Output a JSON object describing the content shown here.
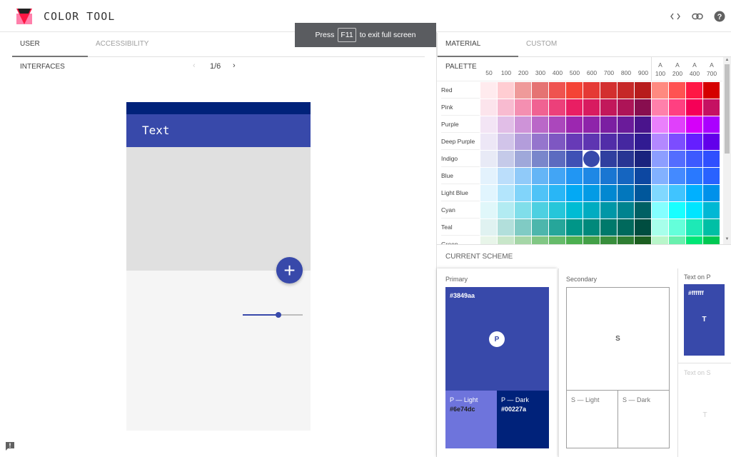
{
  "app": {
    "title": "COLOR TOOL"
  },
  "header_icons": [
    {
      "name": "code-icon",
      "glyph": "<>"
    },
    {
      "name": "link-icon",
      "glyph": "link"
    },
    {
      "name": "help-icon",
      "glyph": "?"
    }
  ],
  "left_tabs": [
    {
      "label": "USER INTERFACES",
      "active": true
    },
    {
      "label": "ACCESSIBILITY",
      "active": false
    }
  ],
  "pager": {
    "prev": "‹",
    "current": "1/6",
    "next": "›"
  },
  "toast": {
    "prefix": "Press",
    "key": "F11",
    "suffix": "to exit full screen"
  },
  "preview": {
    "appbar_text": "Text",
    "fab_glyph": "+",
    "slider_value": 0.6
  },
  "right_tabs": [
    {
      "label": "MATERIAL PALETTE",
      "active": true
    },
    {
      "label": "CUSTOM",
      "active": false
    }
  ],
  "palette": {
    "columns": [
      "50",
      "100",
      "200",
      "300",
      "400",
      "500",
      "600",
      "700",
      "800",
      "900",
      "A 100",
      "A 200",
      "A 400",
      "A 700"
    ],
    "selected": {
      "row": "Indigo",
      "column": "600"
    },
    "rows": [
      {
        "name": "Red",
        "colors": [
          "#ffebee",
          "#ffcdd2",
          "#ef9a9a",
          "#e57373",
          "#ef5350",
          "#f44336",
          "#e53935",
          "#d32f2f",
          "#c62828",
          "#b71c1c",
          "#ff8a80",
          "#ff5252",
          "#ff1744",
          "#d50000"
        ]
      },
      {
        "name": "Pink",
        "colors": [
          "#fce4ec",
          "#f8bbd0",
          "#f48fb1",
          "#f06292",
          "#ec407a",
          "#e91e63",
          "#d81b60",
          "#c2185b",
          "#ad1457",
          "#880e4f",
          "#ff80ab",
          "#ff4081",
          "#f50057",
          "#c51162"
        ]
      },
      {
        "name": "Purple",
        "colors": [
          "#f3e5f5",
          "#e1bee7",
          "#ce93d8",
          "#ba68c8",
          "#ab47bc",
          "#9c27b0",
          "#8e24aa",
          "#7b1fa2",
          "#6a1b9a",
          "#4a148c",
          "#ea80fc",
          "#e040fb",
          "#d500f9",
          "#aa00ff"
        ]
      },
      {
        "name": "Deep Purple",
        "colors": [
          "#ede7f6",
          "#d1c4e9",
          "#b39ddb",
          "#9575cd",
          "#7e57c2",
          "#673ab7",
          "#5e35b1",
          "#512da8",
          "#4527a0",
          "#311b92",
          "#b388ff",
          "#7c4dff",
          "#651fff",
          "#6200ea"
        ]
      },
      {
        "name": "Indigo",
        "colors": [
          "#e8eaf6",
          "#c5cae9",
          "#9fa8da",
          "#7986cb",
          "#5c6bc0",
          "#3f51b5",
          "#3949ab",
          "#303f9f",
          "#283593",
          "#1a237e",
          "#8c9eff",
          "#536dfe",
          "#3d5afe",
          "#304ffe"
        ]
      },
      {
        "name": "Blue",
        "colors": [
          "#e3f2fd",
          "#bbdefb",
          "#90caf9",
          "#64b5f6",
          "#42a5f5",
          "#2196f3",
          "#1e88e5",
          "#1976d2",
          "#1565c0",
          "#0d47a1",
          "#82b1ff",
          "#448aff",
          "#2979ff",
          "#2962ff"
        ]
      },
      {
        "name": "Light Blue",
        "colors": [
          "#e1f5fe",
          "#b3e5fc",
          "#81d4fa",
          "#4fc3f7",
          "#29b6f6",
          "#03a9f4",
          "#039be5",
          "#0288d1",
          "#0277bd",
          "#01579b",
          "#80d8ff",
          "#40c4ff",
          "#00b0ff",
          "#0091ea"
        ]
      },
      {
        "name": "Cyan",
        "colors": [
          "#e0f7fa",
          "#b2ebf2",
          "#80deea",
          "#4dd0e1",
          "#26c6da",
          "#00bcd4",
          "#00acc1",
          "#0097a7",
          "#00838f",
          "#006064",
          "#84ffff",
          "#18ffff",
          "#00e5ff",
          "#00b8d4"
        ]
      },
      {
        "name": "Teal",
        "colors": [
          "#e0f2f1",
          "#b2dfdb",
          "#80cbc4",
          "#4db6ac",
          "#26a69a",
          "#009688",
          "#00897b",
          "#00796b",
          "#00695c",
          "#004d40",
          "#a7ffeb",
          "#64ffda",
          "#1de9b6",
          "#00bfa5"
        ]
      },
      {
        "name": "Green",
        "colors": [
          "#e8f5e9",
          "#c8e6c9",
          "#a5d6a7",
          "#81c784",
          "#66bb6a",
          "#4caf50",
          "#43a047",
          "#388e3c",
          "#2e7d32",
          "#1b5e20",
          "#b9f6ca",
          "#69f0ae",
          "#00e676",
          "#00c853"
        ]
      }
    ]
  },
  "scheme": {
    "title": "CURRENT SCHEME",
    "primary": {
      "label": "Primary",
      "hex": "#3849aa",
      "badge": "P",
      "light": {
        "label": "P — Light",
        "hex": "#6e74dc"
      },
      "dark": {
        "label": "P — Dark",
        "hex": "#00227a"
      }
    },
    "secondary": {
      "label": "Secondary",
      "badge": "S",
      "light": {
        "label": "S — Light"
      },
      "dark": {
        "label": "S — Dark"
      }
    },
    "text_on_p": {
      "label": "Text on P",
      "hex": "#ffffff",
      "badge": "T"
    },
    "text_on_s": {
      "label": "Text on S",
      "badge": "T"
    }
  },
  "colors": {
    "primary": "#3849aa",
    "primary_light": "#6e74dc",
    "primary_dark": "#00227a"
  }
}
